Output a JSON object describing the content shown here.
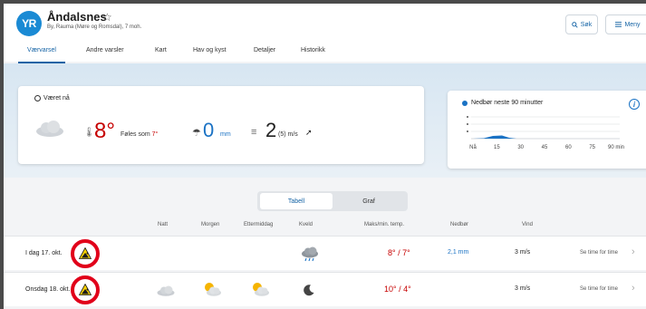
{
  "header": {
    "logo": "YR",
    "title": "Åndalsnes",
    "star": "☆",
    "subtitle": "By, Rauma (Møre og Romsdal), 7 moh.",
    "search_label": "Søk",
    "menu_label": "Meny"
  },
  "tabs": [
    {
      "label": "Værvarsel",
      "active": true
    },
    {
      "label": "Andre varsler"
    },
    {
      "label": "Kart"
    },
    {
      "label": "Hav og kyst"
    },
    {
      "label": "Detaljer"
    },
    {
      "label": "Historikk"
    }
  ],
  "now": {
    "title": "Været nå",
    "temperature": "8°",
    "feels_label": "Føles som",
    "feels_value": "7°",
    "precip_value": "0",
    "precip_unit": "mm",
    "wind_value": "2",
    "wind_unit": "(5) m/s",
    "wind_arrow": "➚"
  },
  "rain90": {
    "title": "Nedbør neste 90 minutter",
    "info": "i",
    "ticks": [
      "Nå",
      "15",
      "30",
      "45",
      "60",
      "75",
      "90 min"
    ]
  },
  "toggle": {
    "table": "Tabell",
    "graph": "Graf"
  },
  "table_headers": {
    "night": "Natt",
    "morning": "Morgen",
    "afternoon": "Ettermiddag",
    "evening": "Kveld",
    "maxmin": "Maks/min. temp.",
    "precip": "Nedbør",
    "wind": "Vind"
  },
  "rows": [
    {
      "date": "I dag 17. okt.",
      "maxmin": "8° / 7°",
      "precip": "2,1 mm",
      "wind": "3 m/s",
      "link": "Se time for time",
      "chevron": "›"
    },
    {
      "date": "Onsdag 18. okt.",
      "maxmin": "10° / 4°",
      "precip": "",
      "wind": "3 m/s",
      "link": "Se time for time",
      "chevron": "›"
    }
  ],
  "icons": {
    "logo": "yr-logo-icon",
    "search": "search-icon",
    "menu": "hamburger-menu-icon",
    "clock": "clock-icon",
    "cloud": "cloud-icon",
    "thermometer": "thermometer-icon",
    "umbrella": "umbrella-icon",
    "wind": "wind-icon",
    "warning": "landslide-warning-icon",
    "partly_cloudy": "partly-cloudy-icon",
    "rain": "rain-cloud-icon",
    "moon": "moon-icon"
  },
  "colors": {
    "brand": "#1a8ad4",
    "accent": "#1463a5",
    "temp": "#c60000",
    "precip": "#1a72c4",
    "warning_ring": "#e1001a",
    "warning_fill": "#f7d000"
  }
}
